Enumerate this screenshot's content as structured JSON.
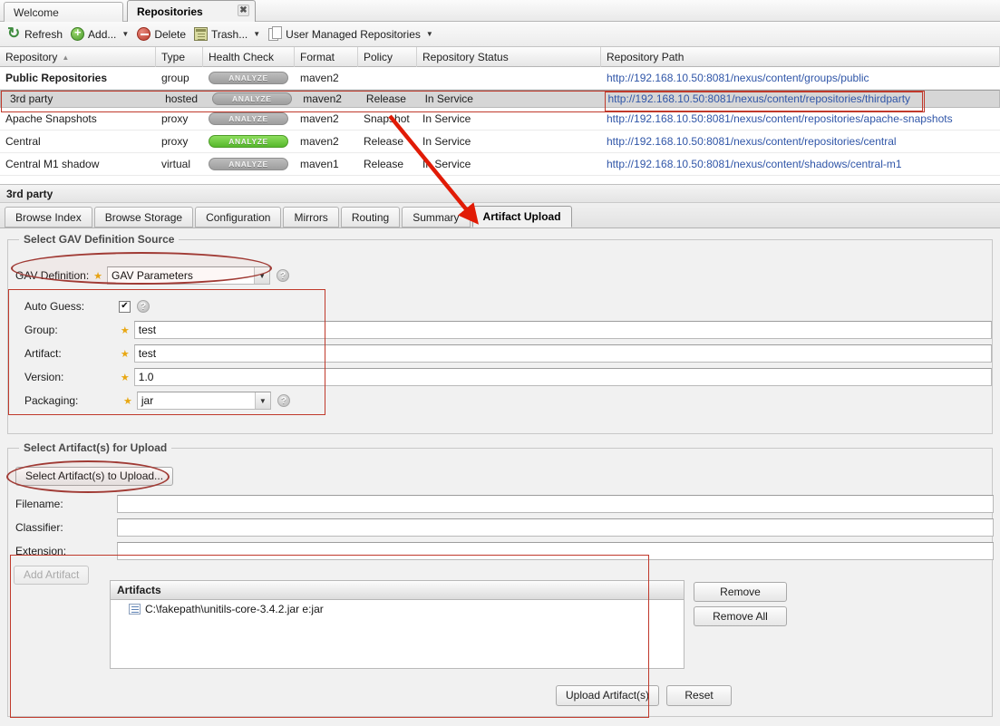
{
  "window": {
    "tabs": [
      {
        "label": "Welcome",
        "active": false,
        "closable": false
      },
      {
        "label": "Repositories",
        "active": true,
        "closable": true,
        "close_glyph": "✖"
      }
    ]
  },
  "toolbar": {
    "items": [
      {
        "label": "Refresh",
        "icon": "refresh-icon",
        "caret": false
      },
      {
        "label": "Add...",
        "icon": "add-icon",
        "caret": true
      },
      {
        "label": "Delete",
        "icon": "delete-icon",
        "caret": false
      },
      {
        "label": "Trash...",
        "icon": "trash-icon",
        "caret": true
      },
      {
        "label": "User Managed Repositories",
        "icon": "pages-icon",
        "caret": true
      }
    ]
  },
  "grid": {
    "columns": [
      {
        "label": "Repository",
        "sorted": true,
        "sort_glyph": "▲"
      },
      {
        "label": "Type"
      },
      {
        "label": "Health Check"
      },
      {
        "label": "Format"
      },
      {
        "label": "Policy"
      },
      {
        "label": "Repository Status"
      },
      {
        "label": "Repository Path"
      }
    ],
    "analyze_label": "ANALYZE",
    "rows": [
      {
        "repository": "Public Repositories",
        "bold": true,
        "type": "group",
        "health": "gray",
        "format": "maven2",
        "policy": "",
        "status": "",
        "path": "http://192.168.10.50:8081/nexus/content/groups/public",
        "selected": false
      },
      {
        "repository": "3rd party",
        "bold": false,
        "type": "hosted",
        "health": "gray",
        "format": "maven2",
        "policy": "Release",
        "status": "In Service",
        "path": "http://192.168.10.50:8081/nexus/content/repositories/thirdparty",
        "selected": true
      },
      {
        "repository": "Apache Snapshots",
        "bold": false,
        "type": "proxy",
        "health": "gray",
        "format": "maven2",
        "policy": "Snapshot",
        "status": "In Service",
        "path": "http://192.168.10.50:8081/nexus/content/repositories/apache-snapshots",
        "selected": false
      },
      {
        "repository": "Central",
        "bold": false,
        "type": "proxy",
        "health": "green",
        "format": "maven2",
        "policy": "Release",
        "status": "In Service",
        "path": "http://192.168.10.50:8081/nexus/content/repositories/central",
        "selected": false
      },
      {
        "repository": "Central M1 shadow",
        "bold": false,
        "type": "virtual",
        "health": "gray",
        "format": "maven1",
        "policy": "Release",
        "status": "In Service",
        "path": "http://192.168.10.50:8081/nexus/content/shadows/central-m1",
        "selected": false
      }
    ]
  },
  "detail": {
    "title": "3rd party",
    "tabs": [
      {
        "label": "Browse Index",
        "active": false
      },
      {
        "label": "Browse Storage",
        "active": false
      },
      {
        "label": "Configuration",
        "active": false
      },
      {
        "label": "Mirrors",
        "active": false
      },
      {
        "label": "Routing",
        "active": false
      },
      {
        "label": "Summary",
        "active": false
      },
      {
        "label": "Artifact Upload",
        "active": true
      }
    ]
  },
  "gav_section": {
    "legend": "Select GAV Definition Source",
    "definition_label": "GAV Definition:",
    "definition_value": "GAV Parameters",
    "help_glyph": "?",
    "auto_guess_label": "Auto Guess:",
    "auto_guess_checked": true,
    "check_glyph": "✔",
    "fields": [
      {
        "label": "Group:",
        "value": "test",
        "type": "text",
        "required": true
      },
      {
        "label": "Artifact:",
        "value": "test",
        "type": "text",
        "required": true
      },
      {
        "label": "Version:",
        "value": "1.0",
        "type": "text",
        "required": true
      },
      {
        "label": "Packaging:",
        "value": "jar",
        "type": "select",
        "required": true
      }
    ]
  },
  "upload_section": {
    "legend": "Select Artifact(s) for Upload",
    "select_button": "Select Artifact(s) to Upload...",
    "fields": [
      {
        "label": "Filename:",
        "value": ""
      },
      {
        "label": "Classifier:",
        "value": ""
      },
      {
        "label": "Extension:",
        "value": ""
      }
    ],
    "add_artifact_button": "Add Artifact",
    "artifacts_header": "Artifacts",
    "artifacts": [
      "C:\\fakepath\\unitils-core-3.4.2.jar e:jar"
    ],
    "remove_button": "Remove",
    "remove_all_button": "Remove All",
    "upload_button": "Upload Artifact(s)",
    "reset_button": "Reset"
  },
  "annotations": {
    "highlight_color": "#c0392b",
    "ellipse_color": "#a03a34",
    "arrow_color": "#e11b06"
  }
}
